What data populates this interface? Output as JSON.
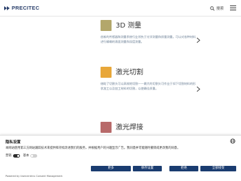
{
  "header": {
    "brand": "PRECITEC",
    "search_label": "搜索"
  },
  "features": [
    {
      "title": "3D 测量",
      "description": "创新的传感器和测量系统行业领先于光学测量和质量测量。可以对各种材料进行精确的表面测量和深度测量。"
    },
    {
      "title": "激光切割",
      "description": "借助了切割头可以高效地切割——最大的切割头可作业于如下切割材料的形状加工以及加工材料的切割，以使最佳质量。"
    },
    {
      "title": "激光焊接",
      "description": ""
    }
  ],
  "consent": {
    "title": "隐私设置",
    "text": "本网站使用第三方网站跟踪技术来提供和持续改进我们的服务，并根据用户的兴趣显示广告。我同意并可能随时撤销或更改我的同意。",
    "toggles": [
      {
        "label": "营销",
        "state": "on"
      },
      {
        "label": "基本",
        "state": "off"
      }
    ],
    "buttons": {
      "more": "更多",
      "save": "保存设置",
      "reject": "拒绝",
      "accept": "全部接受"
    },
    "powered_by": "Powered by Usercentrics Consent Management"
  },
  "colors": {
    "brand_navy": "#1a3c70",
    "logo_blue": "#2a3f6b",
    "thumb_3d": "#b3a76b",
    "thumb_cut": "#e8a73a",
    "thumb_weld": "#b86a6a"
  },
  "icons": {
    "search": "magnifier",
    "menu": "hamburger",
    "next": "chevron-right",
    "language": "globe"
  }
}
